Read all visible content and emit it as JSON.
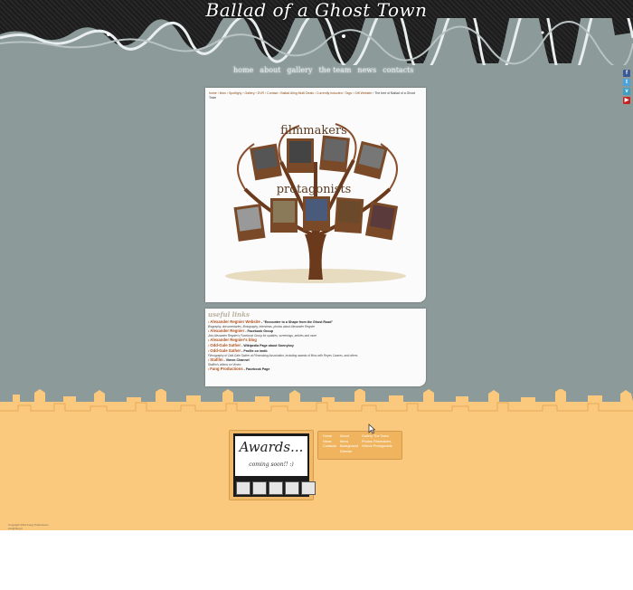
{
  "header": {
    "title": "Ballad of a Ghost Town"
  },
  "nav": {
    "items": [
      "home",
      "about",
      "gallery",
      "the team",
      "news",
      "contacts"
    ]
  },
  "social": [
    {
      "icon": "facebook-icon",
      "color": "#3b5998",
      "glyph": "f"
    },
    {
      "icon": "twitter-icon",
      "color": "#4aa3df",
      "glyph": "t"
    },
    {
      "icon": "vimeo-icon",
      "color": "#3aa0c8",
      "glyph": "v"
    },
    {
      "icon": "youtube-icon",
      "color": "#cc2020",
      "glyph": "▶"
    }
  ],
  "breadcrumb": {
    "path": "home › links › Spotlighy › Gallery › DVR › Contact › Ballad Aling Multi Deals › Currently Inducted › Tags › Gift Website",
    "current": "› The tree of Ballad of a Ghost Town"
  },
  "tree": {
    "label_top": "filmmakers",
    "label_bottom": "protagonists"
  },
  "links": {
    "title": "useful links",
    "items": [
      {
        "name": "Alexander Regnier Website",
        "desc": " - \"Encounter to a Shape from the Ghost Road\"",
        "sub": "Biography, documentaries, filmography, interviews, photos about Alexander Regnier"
      },
      {
        "name": "Alexander Regnier",
        "desc": " - Facebook Group",
        "sub": "Join Alexander Regnier's Facebook Group for updates, screenings, articles and more"
      },
      {
        "name": "Alexander Regnier's blog",
        "desc": "",
        "sub": ""
      },
      {
        "name": "Odd-Gale Sather",
        "desc": " - Wikipedia Page about Sonnyboy",
        "sub": ""
      },
      {
        "name": "Odd-Gale Sather",
        "desc": " - Profile on imdb",
        "sub": "Filmography of Odd-Gale Sather at Filmmaking Association, including awards of films with Reyes Cannes, and others"
      },
      {
        "name": "Stafilm",
        "desc": " - Vimeo Channel",
        "sub": "Stafilm's videos on Vimeo"
      },
      {
        "name": "Fang Productions",
        "desc": " - Facebook Page",
        "sub": ""
      }
    ]
  },
  "awards": {
    "title": "Awards...",
    "subtitle": "coming soon!! :)"
  },
  "footer_nav": {
    "col1": [
      "Home",
      "News",
      "Contacts"
    ],
    "col2": [
      "About",
      "Items",
      "Background",
      "Director"
    ],
    "col3": [
      "Gallery  The Team",
      "Photos  Filmmakers",
      "Videos  Protagonists"
    ]
  },
  "copyright": {
    "line1": "Copyright 2010 Fang Productions",
    "line2": "info@fang.it"
  },
  "colors": {
    "sky": "#8c9a9a",
    "ground": "#fbc97e",
    "header": "#1c1c1c",
    "accent": "#b0501a"
  }
}
